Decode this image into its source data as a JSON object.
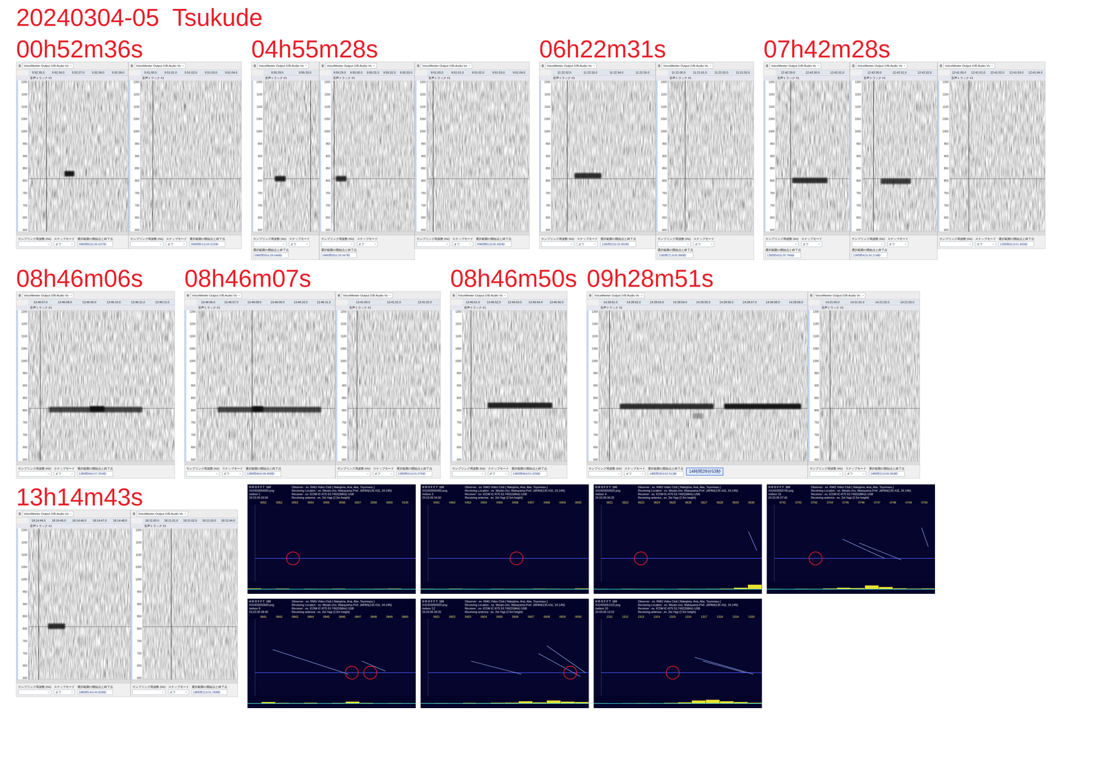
{
  "title": "20240304-05  Tsukude",
  "audacity": {
    "device": "VoiceMeeter Output (VB-Audio Vo",
    "track": "音声トラック #1",
    "freqs": [
      "1200",
      "1150",
      "1100",
      "1050",
      "1000",
      "950",
      "900",
      "850",
      "800",
      "750",
      "700",
      "650",
      "600"
    ],
    "rateLabel": "サンプリング周波数 (Hz)",
    "snapLabel": "スナップモード",
    "snapValue": "オフ",
    "selectionLabel": "選択範囲の開始点と終了点",
    "carrier": 810
  },
  "rows": [
    [
      {
        "label": "00h52m36s",
        "panels": [
          {
            "ticks": [
              "5:52:35.0",
              "5:52:36.0",
              "5:52:37.0",
              "5:52:38.0",
              "5:52:39.0"
            ],
            "echoes": [
              {
                "start": 0.36,
                "end": 0.46,
                "freq": 830,
                "strength": 0.95
              }
            ],
            "cursor": 0.18,
            "selection": "05時間52分36.537秒"
          },
          {
            "ticks": [
              "5:51:00.0",
              "5:51:01.0",
              "5:51:02.0",
              "5:51:03.0",
              "5:51:04.0"
            ],
            "echoes": [],
            "cursor": 0.12,
            "selection": "05時間51分00.522秒"
          }
        ]
      },
      {
        "label": "04h55m28s",
        "panels": [
          {
            "ticks": [
              "9:55:28.0",
              "9:55:29.0"
            ],
            "echoes": [
              {
                "start": 0.2,
                "end": 0.4,
                "freq": 810,
                "strength": 0.9
              }
            ],
            "cursor": 0.85,
            "selection": "09時間55分28.645秒"
          },
          {
            "ticks": [
              "9:55:29.0",
              "9:55:30.0",
              "9:55:31.0",
              "9:55:32.0",
              "9:55:33.0"
            ],
            "echoes": [
              {
                "start": 0.05,
                "end": 0.18,
                "freq": 810,
                "strength": 0.85
              }
            ],
            "cursor": 0.03,
            "selection": "09時間55分29.067秒"
          },
          {
            "ticks": [
              "9:51:00.0",
              "9:51:01.0",
              "9:51:02.0",
              "9:51:03.0",
              "9:51:04.0"
            ],
            "echoes": [],
            "cursor": 0.06,
            "selection": "09時間51分00.392秒"
          }
        ]
      },
      {
        "label": "06h22m31s",
        "panels": [
          {
            "ticks": [
              "11:22:32.0",
              "11:22:33.0",
              "11:22:34.0",
              "11:22:35.0"
            ],
            "echoes": [
              {
                "start": 0.22,
                "end": 0.48,
                "freq": 822,
                "strength": 0.85
              }
            ],
            "cursor": 0.15,
            "selection": "11時間22分32.802秒"
          },
          {
            "ticks": [
              "11:21:00.0",
              "11:21:01.0",
              "11:21:02.0",
              "11:21:03.0"
            ],
            "echoes": [],
            "cursor": 0.2,
            "selection": "11時間21分00.886秒"
          }
        ]
      },
      {
        "label": "07h42m28s",
        "panels": [
          {
            "ticks": [
              "12:42:29.0",
              "12:42:30.0",
              "12:42:31.0"
            ],
            "echoes": [
              {
                "start": 0.22,
                "end": 0.7,
                "freq": 803,
                "strength": 0.85
              }
            ],
            "cursor": 0.2,
            "selection": "12時間42分29.766秒"
          },
          {
            "ticks": [
              "12:42:30.0",
              "12:42:31.0",
              "12:42:32.0"
            ],
            "echoes": [
              {
                "start": 0.25,
                "end": 0.65,
                "freq": 800,
                "strength": 0.8
              }
            ],
            "cursor": 0.15,
            "selection": "12時間42分30.214秒"
          },
          {
            "ticks": [
              "12:41:00.0",
              "12:41:01.0",
              "12:41:02.0",
              "12:41:03.0",
              "12:41:04.0"
            ],
            "echoes": [],
            "cursor": 0.2,
            "selection": "12時間41分01.460秒"
          }
        ]
      }
    ],
    [
      {
        "label": "08h46m06s",
        "panels": [
          {
            "ticks": [
              "13:46:07.0",
              "13:46:08.0",
              "13:46:09.0",
              "13:46:10.0",
              "13:46:11.0",
              "13:46:12.0"
            ],
            "echoes": [
              {
                "start": 0.14,
                "end": 0.78,
                "freq": 805,
                "strength": 0.75
              },
              {
                "start": 0.42,
                "end": 0.52,
                "freq": 808,
                "strength": 0.95
              }
            ],
            "cursor": 0.08,
            "selection": "13時間46分07.254秒"
          }
        ]
      },
      {
        "label": "08h46m07s",
        "panels": [
          {
            "ticks": [
              "13:46:06.0",
              "13:46:07.0",
              "13:46:08.0",
              "13:46:09.0",
              "13:46:10.0",
              "13:46:11.0"
            ],
            "echoes": [
              {
                "start": 0.15,
                "end": 0.9,
                "freq": 805,
                "strength": 0.75
              },
              {
                "start": 0.4,
                "end": 0.48,
                "freq": 808,
                "strength": 0.95
              }
            ],
            "cursor": 0.4,
            "selection": "13時間46分08.458秒"
          },
          {
            "ticks": [
              "13:41:00.0",
              "13:41:01.0",
              "13:41:02.0"
            ],
            "echoes": [],
            "cursor": 0.1,
            "selection": "13時間41分01.076秒"
          }
        ]
      },
      {
        "label": "08h46m50s",
        "panels": [
          {
            "ticks": [
              "13:46:51.0",
              "13:46:52.0",
              "13:46:53.0",
              "13:46:54.0",
              "13:46:55.0"
            ],
            "echoes": [
              {
                "start": 0.24,
                "end": 0.86,
                "freq": 822,
                "strength": 0.9
              }
            ],
            "cursor": 0.08,
            "selection": "13時間46分51.929秒"
          }
        ]
      },
      {
        "label": "09h28m51s",
        "panels": [
          {
            "ticks": [
              "14:28:51.0",
              "14:28:52.0",
              "14:28:53.0",
              "14:28:54.0",
              "14:28:55.0",
              "14:28:56.0",
              "14:28:57.0",
              "14:28:58.0",
              "14:28:59.0"
            ],
            "echoes": [
              {
                "start": 0.1,
                "end": 0.55,
                "freq": 818,
                "strength": 0.85
              },
              {
                "start": 0.6,
                "end": 0.97,
                "freq": 818,
                "strength": 0.95
              },
              {
                "start": 0.45,
                "end": 0.5,
                "freq": 780,
                "strength": 0.3
              }
            ],
            "cursor": 0.05,
            "selection": "14時間28分52.513秒",
            "badge": "14時間28分53秒"
          },
          {
            "ticks": [
              "14:21:00.0",
              "14:21:01.0",
              "14:21:02.0",
              "14:21:03.0"
            ],
            "echoes": [],
            "cursor": 0.1,
            "selection": "14時間21分00.963秒"
          }
        ]
      }
    ],
    [
      {
        "label": "13h14m43s",
        "panels": [
          {
            "ticks": [
              "18:14:44.0",
              "18:14:45.0",
              "18:14:46.0",
              "18:14:47.0",
              "18:14:48.0"
            ],
            "echoes": [
              {
                "start": 0.19,
                "end": 0.36,
                "freq": 812,
                "strength": 0.85
              }
            ],
            "cursor": 0.1,
            "selection": "18時間14分44.828秒"
          },
          {
            "ticks": [
              "18:11:00.0",
              "18:11:01.0",
              "18:11:02.0",
              "18:11:03.0",
              "18:11:04.0"
            ],
            "echoes": [],
            "cursor": 0.3,
            "selection": "18時間11分01.058秒"
          }
        ]
      }
    ]
  ],
  "hrofft": {
    "logo": "H R O F F T  100",
    "observer": "Observer : ex. RMG Video Club [ Nakajima, Arai, Abe, Toyomasu ]",
    "location": "Receiving Location : ex. Misato-cho, Wakayama-Pref. JAPAN(135.41E, 34.14N)",
    "receiver": "Receiver : ex. ICOM IC-R75 53.74922(MHz) USB",
    "antenna": "Receiving antenna : ex. 2el-Yagi (2.5m height)",
    "meteorLabel": "meteor",
    "panels": [
      {
        "file": "XX2403050050.png",
        "count": "1",
        "date": "24.03.05 00:50",
        "ticks": [
          "0051",
          "0052",
          "0053",
          "0054",
          "0055",
          "0056",
          "0057",
          "0058",
          "0059",
          "0100"
        ],
        "circles": [
          0.27
        ],
        "streaks": [],
        "noise": [
          0.1,
          0.05,
          0.08,
          0.04,
          0.06,
          0.05,
          0.07,
          0.04,
          0.05,
          0.06,
          0.08,
          0.05
        ]
      },
      {
        "file": "XX2403050450.png",
        "count": "3",
        "date": "24.03.05 04:50",
        "ticks": [
          "0451",
          "0452",
          "0453",
          "0454",
          "0455",
          "0456",
          "0457",
          "0458",
          "0459",
          "0500"
        ],
        "circles": [
          0.57
        ],
        "streaks": [],
        "noise": [
          0.06,
          0.05,
          0.07,
          0.05,
          0.04,
          0.06,
          0.05,
          0.05,
          0.07,
          0.06,
          0.05,
          0.1
        ]
      },
      {
        "file": "XX2403050620.png",
        "count": "4",
        "date": "24.03.05 06:20",
        "ticks": [
          "0621",
          "0622",
          "0623",
          "0624",
          "0625",
          "0626",
          "0627",
          "0628",
          "0629",
          "0630"
        ],
        "circles": [
          0.28
        ],
        "streaks": [
          [
            0.92,
            0.35,
            0.97,
            0.6
          ]
        ],
        "noise": [
          0.05,
          0.04,
          0.06,
          0.05,
          0.05,
          0.04,
          0.06,
          0.05,
          0.06,
          0.08,
          0.2,
          0.6
        ]
      },
      {
        "file": "XX2403050740.png",
        "count": "16",
        "date": "24.03.05 07:40",
        "ticks": [
          "0741",
          "0742",
          "0743",
          "0744",
          "0745",
          "0746",
          "0747",
          "0748",
          "0749",
          "0750"
        ],
        "circles": [
          0.29
        ],
        "streaks": [
          [
            0.45,
            0.45,
            0.7,
            0.7
          ],
          [
            0.55,
            0.5,
            0.8,
            0.72
          ],
          [
            0.92,
            0.3,
            0.96,
            0.55
          ]
        ],
        "noise": [
          0.05,
          0.04,
          0.06,
          0.05,
          0.1,
          0.2,
          0.15,
          0.5,
          0.3,
          0.12,
          0.08,
          0.1
        ]
      },
      {
        "file": "XX2403050840.png",
        "count": "8",
        "date": "24.03.05 08:40",
        "ticks": [
          "0841",
          "0842",
          "0843",
          "0844",
          "0845",
          "0846",
          "0847",
          "0848",
          "0849",
          "0850"
        ],
        "circles": [
          0.62,
          0.73
        ],
        "streaks": [
          [
            0.15,
            0.4,
            0.6,
            0.72
          ],
          [
            0.68,
            0.55,
            0.82,
            0.68
          ]
        ],
        "noise": [
          0.05,
          0.2,
          0.08,
          0.06,
          0.1,
          0.05,
          0.07,
          0.25,
          0.08,
          0.05,
          0.06,
          0.05
        ]
      },
      {
        "file": "XX2403050920.png",
        "count": "12",
        "date": "24.03.05 09:20",
        "ticks": [
          "0921",
          "0922",
          "0923",
          "0924",
          "0925",
          "0926",
          "0927",
          "0928",
          "0929",
          "0930"
        ],
        "circles": [
          0.89
        ],
        "streaks": [
          [
            0.3,
            0.55,
            0.6,
            0.72
          ],
          [
            0.7,
            0.45,
            0.95,
            0.75
          ],
          [
            0.75,
            0.35,
            0.98,
            0.7
          ]
        ],
        "noise": [
          0.05,
          0.06,
          0.05,
          0.08,
          0.06,
          0.1,
          0.12,
          0.3,
          0.15,
          0.4,
          0.25,
          0.2
        ]
      },
      {
        "file": "XX2403051310.png",
        "count": "10",
        "date": "24.03.05 13:10",
        "ticks": [
          "1311",
          "1312",
          "1313",
          "1314",
          "1315",
          "1316",
          "1317",
          "1318",
          "1319",
          "1320"
        ],
        "circles": [
          0.47
        ],
        "streaks": [
          [
            0.6,
            0.5,
            0.95,
            0.72
          ],
          [
            0.65,
            0.55,
            0.9,
            0.7
          ]
        ],
        "noise": [
          0.05,
          0.04,
          0.05,
          0.06,
          0.05,
          0.08,
          0.15,
          0.4,
          0.5,
          0.3,
          0.2,
          0.1
        ]
      }
    ]
  }
}
